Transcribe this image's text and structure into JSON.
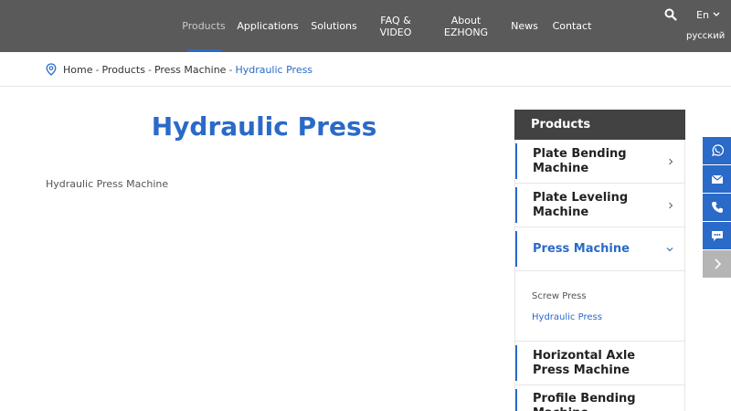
{
  "nav": {
    "items": [
      {
        "label": "Products"
      },
      {
        "label": "Applications"
      },
      {
        "label": "Solutions"
      },
      {
        "label": "FAQ &\nVIDEO"
      },
      {
        "label": "About\nEZHONG"
      },
      {
        "label": "News"
      },
      {
        "label": "Contact"
      }
    ],
    "active_index": 0,
    "lang": "En",
    "lang_alt": "русский"
  },
  "breadcrumb": {
    "items": [
      "Home",
      "Products",
      "Press Machine"
    ],
    "current": "Hydraulic Press",
    "separator": "-"
  },
  "main": {
    "title": "Hydraulic Press",
    "description": "Hydraulic Press Machine"
  },
  "sidebar": {
    "heading": "Products",
    "items": [
      {
        "label": "Plate Bending Machine"
      },
      {
        "label": "Plate Leveling Machine"
      },
      {
        "label": "Press Machine"
      },
      {
        "label": "Horizontal Axle Press Machine"
      },
      {
        "label": "Profile Bending Machine"
      }
    ],
    "subitems": [
      {
        "label": "Screw Press"
      },
      {
        "label": "Hydraulic Press"
      }
    ]
  },
  "floating": {
    "icons": [
      "whatsapp-icon",
      "email-icon",
      "phone-icon",
      "chat-icon",
      "chevron-right-icon"
    ]
  },
  "colors": {
    "accent": "#2a6ac8",
    "header_bg": "#5a5a5a",
    "sidebar_head_bg": "#424242"
  }
}
